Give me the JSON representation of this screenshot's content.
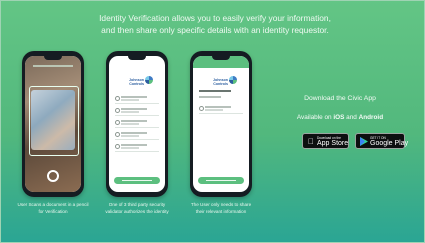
{
  "headline": {
    "line1": "Identity Verification allows you to easily verify your information,",
    "line2": "and then share only specific details with an identity requestor."
  },
  "phones": [
    {
      "screen": "camera-scan"
    },
    {
      "screen": "record-list",
      "brand_line1": "Johnson",
      "brand_line2": "Controls"
    },
    {
      "screen": "approve-authorization",
      "brand_line1": "Johnson",
      "brand_line2": "Controls"
    }
  ],
  "captions": [
    {
      "line1": "User Scans a document in a pencil",
      "line2": "for Verification"
    },
    {
      "line1": "One of 3 third party security",
      "line2": "validator authorizes the identity"
    },
    {
      "line1": "The User only needs to share",
      "line2": "their relevant information"
    }
  ],
  "download": {
    "title": "Download the Civic App",
    "available_prefix": "Available on ",
    "ios": "iOS",
    "and": " and ",
    "android": "Android"
  },
  "badges": {
    "appstore_small": "Download on the",
    "appstore_big": "App Store",
    "googleplay_small": "GET IT ON",
    "googleplay_big": "Google Play"
  },
  "colors": {
    "background_top": "#63c585",
    "background_bottom": "#2aa594",
    "accent_green": "#5cbf7f",
    "brand_blue": "#2d5fa0"
  },
  "icons": [
    "apple-icon",
    "google-play-icon",
    "company-logo-icon",
    "list-row-icon"
  ]
}
